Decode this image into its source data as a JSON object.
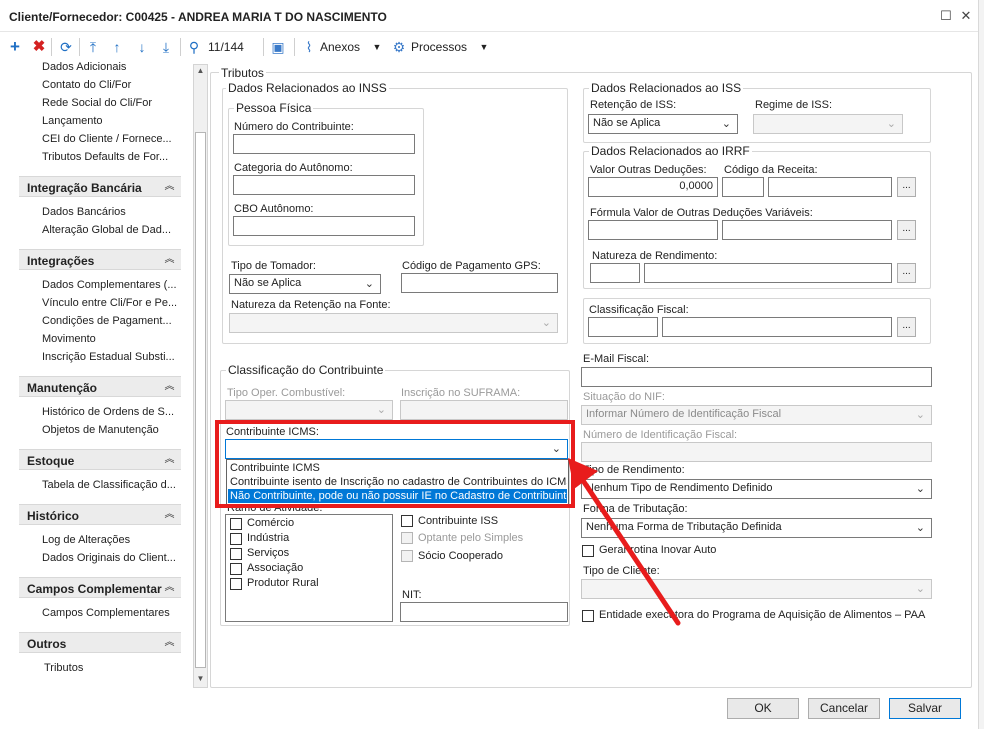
{
  "window": {
    "title": "Cliente/Fornecedor: C00425 - ANDREA MARIA T DO NASCIMENTO",
    "maximize_icon": "maximize-icon",
    "close_icon": "close-icon"
  },
  "toolbar": {
    "record_counter": "11/144",
    "attachments_label": "Anexos",
    "processes_label": "Processos"
  },
  "sidebar": {
    "top_items": [
      "Dados Adicionais",
      "Contato do Cli/For",
      "Rede Social do Cli/For",
      "Lançamento",
      "CEI do Cliente / Fornece...",
      "Tributos Defaults de For..."
    ],
    "sections": [
      {
        "title": "Integração Bancária",
        "items": [
          "Dados Bancários",
          "Alteração Global de Dad..."
        ]
      },
      {
        "title": "Integrações",
        "items": [
          "Dados Complementares (...",
          "Vínculo entre Cli/For e Pe...",
          "Condições de Pagament...",
          "Movimento",
          "Inscrição Estadual Substi..."
        ]
      },
      {
        "title": "Manutenção",
        "items": [
          "Histórico de Ordens de S...",
          "Objetos de Manutenção"
        ]
      },
      {
        "title": "Estoque",
        "items": [
          "Tabela de Classificação d..."
        ]
      },
      {
        "title": "Histórico",
        "items": [
          "Log de Alterações",
          "Dados Originais do Client..."
        ]
      },
      {
        "title": "Campos Complementar",
        "items": [
          "Campos Complementares"
        ]
      },
      {
        "title": "Outros",
        "items": [
          "Tributos"
        ]
      }
    ]
  },
  "form": {
    "tab_title": "Tributos",
    "inss": {
      "group_title": "Dados Relacionados ao INSS",
      "pf_title": "Pessoa Física",
      "numero_label": "Número do Contribuinte:",
      "categoria_label": "Categoria do Autônomo:",
      "cbo_label": "CBO Autônomo:",
      "tomador_label": "Tipo de Tomador:",
      "tomador_value": "Não se Aplica",
      "gps_label": "Código de Pagamento GPS:",
      "natureza_label": "Natureza da Retenção na Fonte:"
    },
    "classificacao": {
      "group_title": "Classificação do Contribuinte",
      "combustivel_label": "Tipo Oper. Combustível:",
      "suframa_label": "Inscrição no SUFRAMA:",
      "icms_label": "Contribuinte ICMS:",
      "icms_options": [
        "Contribuinte ICMS",
        "Contribuinte isento de Inscrição no cadastro de Contribuintes do ICMS",
        "Não Contribuinte, pode ou não possuir IE no Cadastro de Contribuintes"
      ],
      "ramo_label": "Ramo de Atividade:",
      "ramo_items": [
        "Comércio",
        "Indústria",
        "Serviços",
        "Associação",
        "Produtor Rural"
      ],
      "iss_check": "Contribuinte ISS",
      "simples_check": "Optante pelo Simples",
      "cooperado_check": "Sócio Cooperado",
      "nit_label": "NIT:"
    },
    "iss": {
      "group_title": "Dados Relacionados ao ISS",
      "retencao_label": "Retenção de ISS:",
      "retencao_value": "Não se Aplica",
      "regime_label": "Regime de ISS:"
    },
    "irrf": {
      "group_title": "Dados Relacionados ao IRRF",
      "deducoes_label": "Valor Outras Deduções:",
      "deducoes_value": "0,0000",
      "receita_label": "Código da Receita:",
      "formula_label": "Fórmula Valor de Outras Deduções Variáveis:",
      "natureza_label": "Natureza de Rendimento:",
      "dots": "..."
    },
    "fiscal": {
      "classificacao_label": "Classificação Fiscal:",
      "email_label": "E-Mail Fiscal:",
      "nif_situacao_label": "Situação do NIF:",
      "nif_situacao_value": "Informar Número de Identificação Fiscal",
      "nif_numero_label": "Número de Identificação Fiscal:",
      "rendimento_label": "Tipo de Rendimento:",
      "rendimento_value": "Nenhum Tipo de Rendimento Definido",
      "tributacao_label": "Forma de Tributação:",
      "tributacao_value": "Nenhuma Forma de Tributação Definida",
      "inovar_check": "Gerar rotina Inovar Auto",
      "tipo_cliente_label": "Tipo de Cliente:",
      "paa_check": "Entidade executora do Programa de Aquisição de Alimentos – PAA"
    }
  },
  "footer": {
    "ok": "OK",
    "cancel": "Cancelar",
    "save": "Salvar"
  },
  "annotation_color": "#e81c1c",
  "highlight_color": "#0078d7"
}
